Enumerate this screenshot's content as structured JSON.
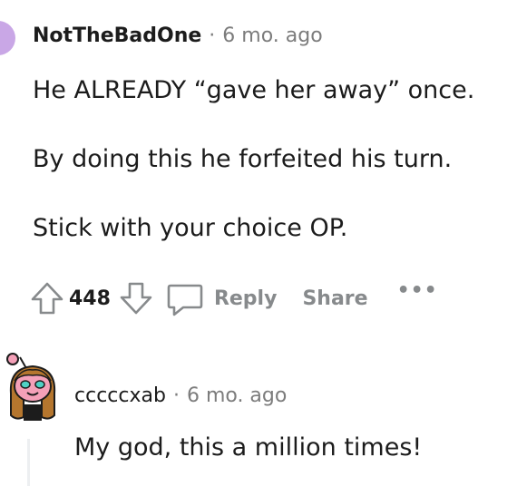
{
  "comment1": {
    "username": "NotTheBadOne",
    "separator": "·",
    "time": "6 mo. ago",
    "paragraphs": [
      "He ALREADY “gave her away” once.",
      "By doing this he forfeited his turn.",
      "Stick with your choice OP."
    ],
    "actions": {
      "vote_count": "448",
      "reply_label": "Reply",
      "share_label": "Share",
      "more_label": "•••"
    }
  },
  "comment2": {
    "username": "cccccxab",
    "separator": "·",
    "time": "6 mo. ago",
    "text": "My god, this a million times!"
  },
  "colors": {
    "text": "#1c1c1c",
    "meta": "#7c7c7c",
    "action": "#878a8c",
    "avatar1": "#c9a7e6",
    "avatar2_face": "#f4a0b8",
    "avatar2_hair": "#b5762e"
  }
}
